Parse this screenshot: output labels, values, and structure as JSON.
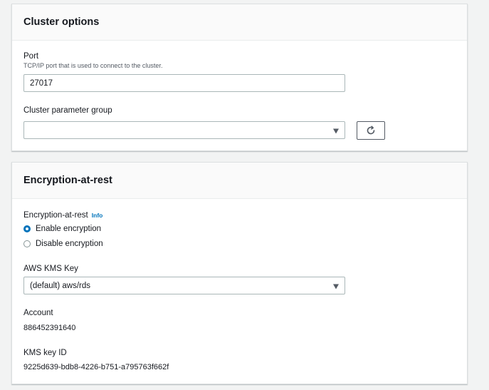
{
  "cluster_options": {
    "title": "Cluster options",
    "port_label": "Port",
    "port_description": "TCP/IP port that is used to connect to the cluster.",
    "port_value": "27017",
    "parameter_group_label": "Cluster parameter group",
    "parameter_group_value": ""
  },
  "encryption": {
    "title": "Encryption-at-rest",
    "field_label": "Encryption-at-rest",
    "info_link": "Info",
    "options": [
      {
        "label": "Enable encryption",
        "selected": true
      },
      {
        "label": "Disable encryption",
        "selected": false
      }
    ],
    "kms_key_label": "AWS KMS Key",
    "kms_key_value": "(default) aws/rds",
    "account_label": "Account",
    "account_value": "886452391640",
    "kms_key_id_label": "KMS key ID",
    "kms_key_id_value": "9225d639-bdb8-4226-b751-a795763f662f"
  },
  "icons": {
    "refresh": "refresh-icon",
    "caret": "caret-down-icon"
  },
  "colors": {
    "accent": "#0073bb",
    "background": "#f2f3f3",
    "panel_header": "#fafafa"
  }
}
